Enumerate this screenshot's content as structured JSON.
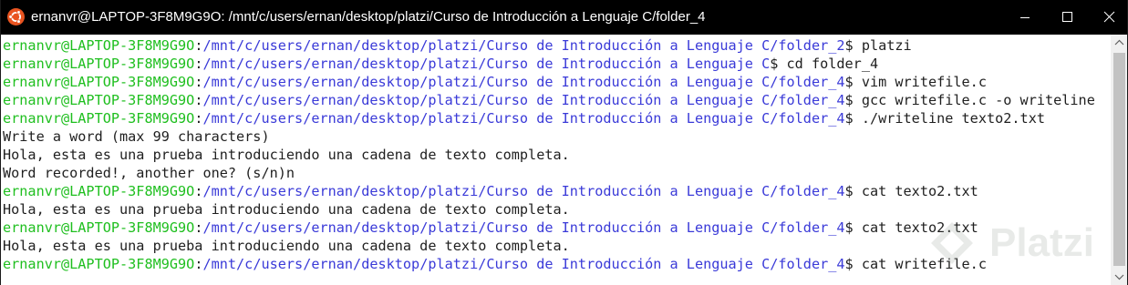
{
  "window": {
    "title": "ernanvr@LAPTOP-3F8M9G9O: /mnt/c/users/ernan/desktop/platzi/Curso de Introducción a Lenguaje C/folder_4",
    "app_icon": "ubuntu-icon",
    "controls": {
      "minimize": "minimize-icon",
      "maximize": "maximize-icon",
      "close": "close-icon"
    }
  },
  "colors": {
    "titlebar": "#000000",
    "prompt_user": "#1fbf1f",
    "prompt_path": "#3a3ad8",
    "text": "#1f1f1f",
    "background": "#ffffff"
  },
  "terminal": {
    "lines": [
      {
        "type": "prompt",
        "user": "ernanvr@LAPTOP-3F8M9G9O",
        "sep": ":",
        "path": "/mnt/c/users/ernan/desktop/platzi/Curso de Introducción a Lenguaje C/folder_2",
        "cmd": "$ platzi"
      },
      {
        "type": "prompt",
        "user": "ernanvr@LAPTOP-3F8M9G9O",
        "sep": ":",
        "path": "/mnt/c/users/ernan/desktop/platzi/Curso de Introducción a Lenguaje C",
        "cmd": "$ cd folder_4"
      },
      {
        "type": "prompt",
        "user": "ernanvr@LAPTOP-3F8M9G9O",
        "sep": ":",
        "path": "/mnt/c/users/ernan/desktop/platzi/Curso de Introducción a Lenguaje C/folder_4",
        "cmd": "$ vim writefile.c"
      },
      {
        "type": "prompt",
        "user": "ernanvr@LAPTOP-3F8M9G9O",
        "sep": ":",
        "path": "/mnt/c/users/ernan/desktop/platzi/Curso de Introducción a Lenguaje C/folder_4",
        "cmd": "$ gcc writefile.c -o writeline"
      },
      {
        "type": "prompt",
        "user": "ernanvr@LAPTOP-3F8M9G9O",
        "sep": ":",
        "path": "/mnt/c/users/ernan/desktop/platzi/Curso de Introducción a Lenguaje C/folder_4",
        "cmd": "$ ./writeline texto2.txt"
      },
      {
        "type": "output",
        "text": "Write a word (max 99 characters)"
      },
      {
        "type": "output",
        "text": "Hola, esta es una prueba introduciendo una cadena de texto completa."
      },
      {
        "type": "output",
        "text": "Word recorded!, another one? (s/n)n"
      },
      {
        "type": "prompt",
        "user": "ernanvr@LAPTOP-3F8M9G9O",
        "sep": ":",
        "path": "/mnt/c/users/ernan/desktop/platzi/Curso de Introducción a Lenguaje C/folder_4",
        "cmd": "$ cat texto2.txt"
      },
      {
        "type": "output",
        "text": "Hola, esta es una prueba introduciendo una cadena de texto completa."
      },
      {
        "type": "prompt",
        "user": "ernanvr@LAPTOP-3F8M9G9O",
        "sep": ":",
        "path": "/mnt/c/users/ernan/desktop/platzi/Curso de Introducción a Lenguaje C/folder_4",
        "cmd": "$ cat texto2.txt"
      },
      {
        "type": "output",
        "text": "Hola, esta es una prueba introduciendo una cadena de texto completa."
      },
      {
        "type": "prompt",
        "user": "ernanvr@LAPTOP-3F8M9G9O",
        "sep": ":",
        "path": "/mnt/c/users/ernan/desktop/platzi/Curso de Introducción a Lenguaje C/folder_4",
        "cmd": "$ cat writefile.c"
      }
    ]
  },
  "watermark": {
    "text": "Platzi",
    "icon": "platzi-logo-icon"
  }
}
